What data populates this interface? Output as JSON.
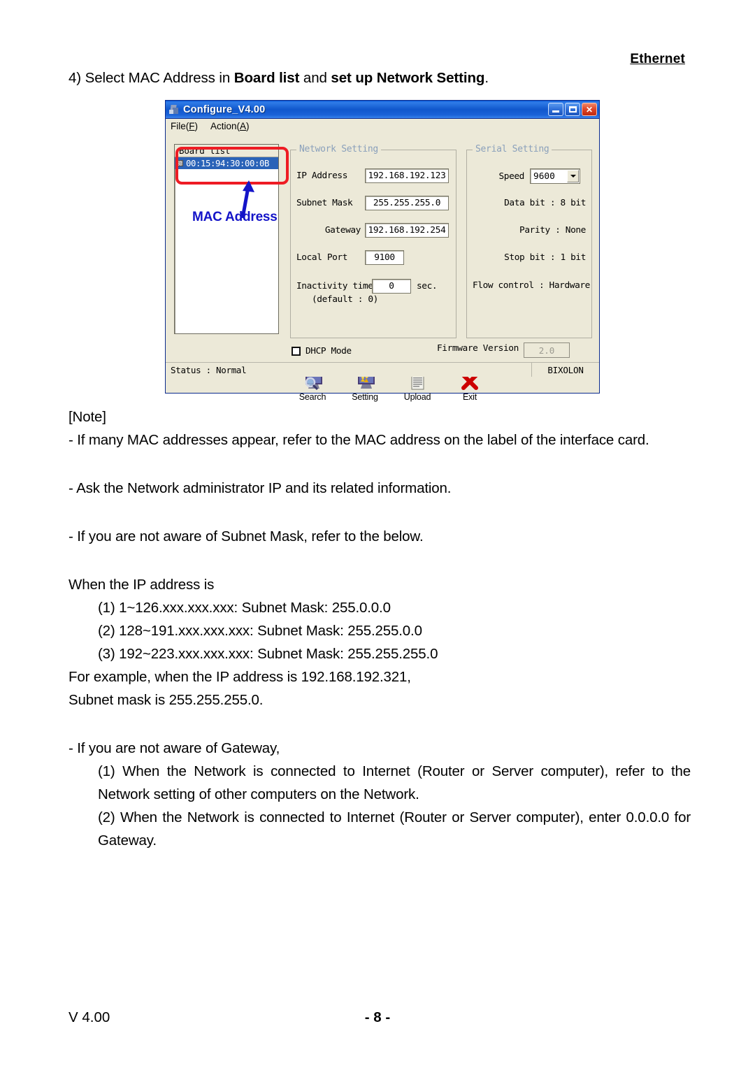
{
  "page": {
    "header_right": "Ethernet",
    "step_prefix": "4) Select MAC Address in ",
    "step_bold1": "Board list",
    "step_mid": " and ",
    "step_bold2": "set up Network Setting",
    "step_suffix": ".",
    "footer_left": "V 4.00",
    "footer_page": "- 8 -"
  },
  "dialog": {
    "title": "Configure_V4.00",
    "window_icon": "app-icon",
    "buttons": {
      "minimize": "minimize-button",
      "maximize": "maximize-button",
      "close": "✕"
    },
    "menu": [
      {
        "text": "File(",
        "accel": "F",
        "tail": ")"
      },
      {
        "text": "Action(",
        "accel": "A",
        "tail": ")"
      }
    ],
    "board_list": {
      "header": "Board list",
      "items": [
        "00:15:94:30:00:0B"
      ],
      "callout": "MAC Address",
      "callout_color": "#1414c8",
      "highlight_color": "#ee1c24"
    },
    "network_setting": {
      "legend": "Network Setting",
      "legend_color": "#8aa0bb",
      "ip_address_label": "IP Address",
      "ip_address_value": "192.168.192.123",
      "subnet_mask_label": "Subnet Mask",
      "subnet_mask_value": "255.255.255.0",
      "gateway_label": "Gateway",
      "gateway_value": "192.168.192.254",
      "local_port_label": "Local Port",
      "local_port_value": "9100",
      "inactivity_label": "Inactivity time",
      "inactivity_default": "(default : 0)",
      "inactivity_value": "0",
      "inactivity_unit": "sec."
    },
    "serial_setting": {
      "legend": "Serial Setting",
      "speed_label": "Speed",
      "speed_value": "9600",
      "data_bit": "Data bit : 8 bit",
      "parity": "Parity : None",
      "stop_bit": "Stop bit : 1 bit",
      "flow_control": "Flow control : Hardware"
    },
    "dhcp_label": "DHCP Mode",
    "dhcp_checked": false,
    "firmware_label": "Firmware Version",
    "firmware_value": "2.0",
    "toolbar": [
      {
        "icon": "search-icon",
        "label": "Search"
      },
      {
        "icon": "setting-icon",
        "label": "Setting"
      },
      {
        "icon": "upload-icon",
        "label": "Upload"
      },
      {
        "icon": "exit-icon",
        "label": "Exit"
      }
    ],
    "status": {
      "text": "Status : Normal",
      "brand": "BIXOLON"
    }
  },
  "notes": {
    "title": "[Note]",
    "line1": "- If many MAC addresses appear, refer to the MAC address on the label of the interface card.",
    "line2": "- Ask the Network administrator IP and its related information.",
    "line3": "- If you are not aware of Subnet Mask, refer to the below.",
    "when_ip": "When the IP address is",
    "subnet_items": [
      "(1) 1~126.xxx.xxx.xxx: Subnet Mask: 255.0.0.0",
      "(2) 128~191.xxx.xxx.xxx: Subnet Mask: 255.255.0.0",
      "(3) 192~223.xxx.xxx.xxx: Subnet Mask: 255.255.255.0"
    ],
    "example1": "For example, when the IP address is 192.168.192.321,",
    "example2": "Subnet mask is 255.255.255.0.",
    "gateway_head": "- If you are not aware of Gateway,",
    "gateway_items": [
      "(1) When the Network is connected to Internet (Router or Server computer), refer to the Network setting of other computers on the Network.",
      "(2) When the Network is connected to Internet (Router or Server computer), enter 0.0.0.0 for Gateway."
    ]
  }
}
